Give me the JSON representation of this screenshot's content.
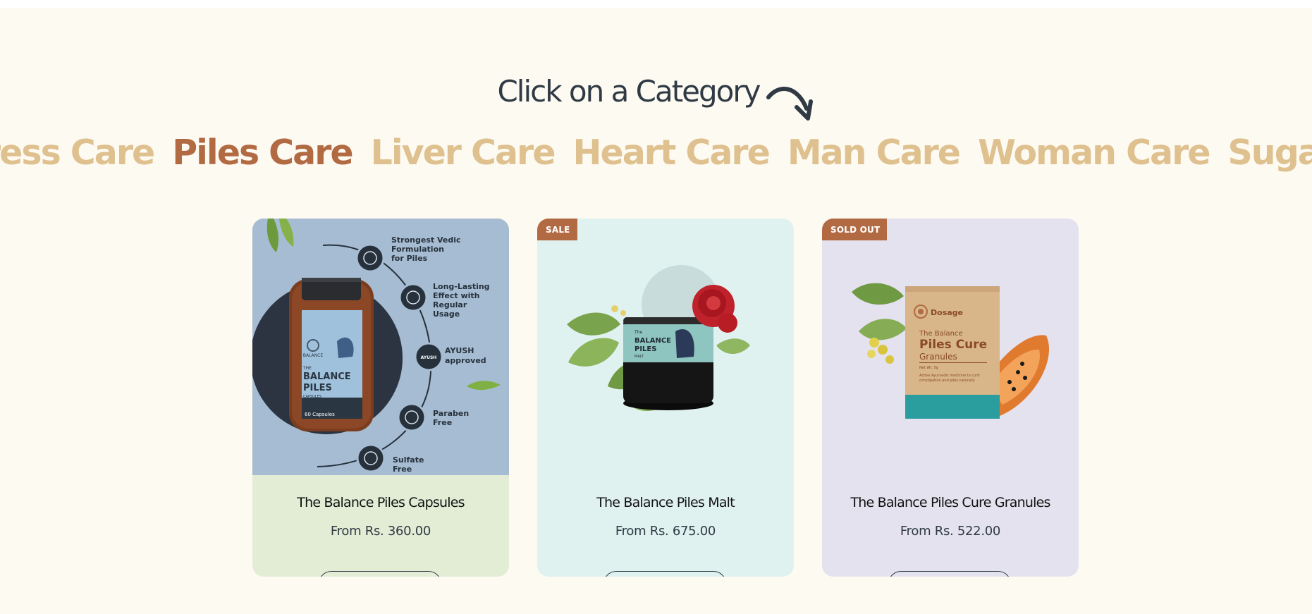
{
  "heading": {
    "text": "Click on a Category"
  },
  "categories": [
    {
      "label": "ress Care"
    },
    {
      "label": "Piles Care"
    },
    {
      "label": "Liver Care"
    },
    {
      "label": "Heart Care"
    },
    {
      "label": "Man Care"
    },
    {
      "label": "Woman Care"
    },
    {
      "label": "Sugar C"
    }
  ],
  "active_category": "Piles Care",
  "colors": {
    "page_bg": "#fdfaf2",
    "heading": "#2f3a44",
    "category": "#dfc18f",
    "category_active": "#b26a43",
    "badge": "#b26a43"
  },
  "products": [
    {
      "title": "The Balance Piles Capsules",
      "price": "From Rs. 360.00",
      "badge": null,
      "image": {
        "bottle_brand": "BALANCE",
        "bottle_line1": "BALANCE",
        "bottle_line2": "PILES",
        "bottle_sub": "CAPSULES",
        "bottle_count": "60 Capsules",
        "bottle_the": "THE",
        "features": [
          {
            "lines": [
              "Strongest Vedic",
              "Formulation",
              "for Piles"
            ]
          },
          {
            "lines": [
              "Long-Lasting",
              "Effect with",
              "Regular",
              "Usage"
            ]
          },
          {
            "lines": [
              "AYUSH",
              "approved"
            ]
          },
          {
            "lines": [
              "Paraben",
              "Free"
            ]
          },
          {
            "lines": [
              "Sulfate",
              "Free"
            ]
          }
        ],
        "ayush_seal": "AYUSH"
      }
    },
    {
      "title": "The Balance Piles Malt",
      "price": "From Rs. 675.00",
      "badge": "SALE",
      "image": {
        "jar_the": "The",
        "jar_line1": "BALANCE",
        "jar_line2": "PILES",
        "jar_sub": "MALT"
      }
    },
    {
      "title": "The Balance Piles Cure Granules",
      "price": "From Rs. 522.00",
      "badge": "SOLD OUT",
      "image": {
        "pack_brand": "Dosage",
        "pack_the": "The Balance",
        "pack_line1": "Piles Cure",
        "pack_line2": "Granules",
        "pack_weight": "Net Wt. 5g",
        "pack_desc1": "Active Ayurvedic medicine to curb",
        "pack_desc2": "constipation and piles naturally"
      }
    }
  ]
}
